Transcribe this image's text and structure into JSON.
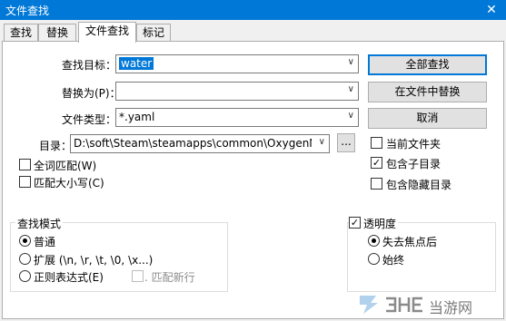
{
  "window": {
    "title": "文件查找",
    "close_glyph": "✕"
  },
  "tabs": [
    {
      "label": "查找"
    },
    {
      "label": "替换"
    },
    {
      "label": "文件查找"
    },
    {
      "label": "标记"
    }
  ],
  "form": {
    "find_label": "查找目标：",
    "find_value": "water",
    "replace_label": "替换为(P)：",
    "replace_value": "",
    "filetype_label": "文件类型：",
    "filetype_value": "*.yaml",
    "dir_label": "目录：",
    "dir_value": "D:\\soft\\Steam\\steamapps\\common\\OxygenNotInclude",
    "browse_label": "..."
  },
  "buttons": {
    "find_all": "全部查找",
    "replace_in_files": "在文件中替换",
    "cancel": "取消"
  },
  "options": {
    "whole_word": "全词匹配(W)",
    "match_case": "匹配大小写(C)",
    "current_folder": "当前文件夹",
    "include_subfolders": "包含子目录",
    "include_hidden": "包含隐藏目录"
  },
  "search_mode": {
    "title": "查找模式",
    "normal": "普通",
    "extended": "扩展 (\\n, \\r, \\t, \\0, \\x...)",
    "regex": "正则表达式(E)",
    "dot_newline": ". 匹配新行"
  },
  "transparency": {
    "title": "透明度",
    "on_lose_focus": "失去焦点后",
    "always": "始终"
  },
  "watermark": {
    "text": "当游网"
  },
  "check_glyph": "✓"
}
